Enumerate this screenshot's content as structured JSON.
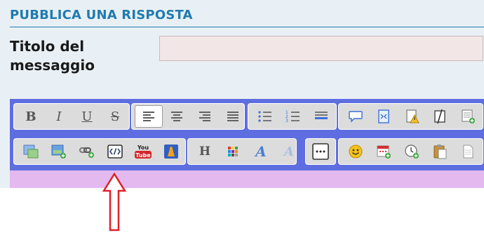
{
  "section_title": "PUBBLICA UNA RISPOSTA",
  "field": {
    "label": "Titolo del messaggio",
    "value": ""
  },
  "toolbar": {
    "text_style": {
      "bold": "B",
      "italic": "I",
      "underline": "U",
      "strike": "S"
    },
    "youtube_label": "YouTube",
    "heading_label": "H",
    "font_label": "A",
    "more_label": "···"
  },
  "colors": {
    "title": "#1f7bb0",
    "editor_bg": "#5e6ee0",
    "editor_body": "#e3b9ef",
    "arrow": "#e0202a"
  }
}
